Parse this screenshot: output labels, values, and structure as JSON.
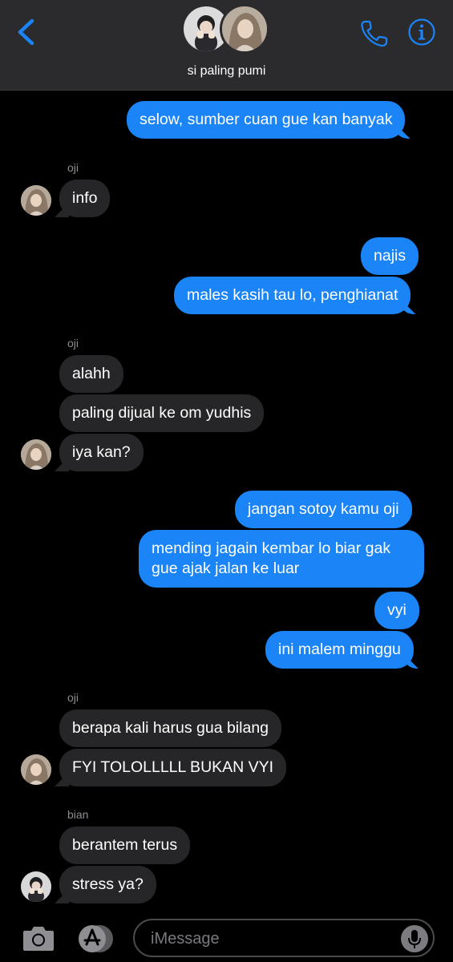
{
  "header": {
    "group_name": "si paling pumi",
    "accent_color": "#1b84f6",
    "icons": [
      "back-chevron-icon",
      "phone-icon",
      "info-icon"
    ]
  },
  "messages": [
    {
      "id": "m1",
      "dir": "out",
      "text": "selow, sumber cuan gue kan banyak"
    },
    {
      "id": "m2",
      "dir": "in",
      "sender": "oji",
      "text": "info"
    },
    {
      "id": "m3",
      "dir": "out",
      "text": "najis"
    },
    {
      "id": "m4",
      "dir": "out",
      "text": "males kasih tau lo, penghianat"
    },
    {
      "id": "m5",
      "dir": "in",
      "sender": "oji",
      "text": "alahh"
    },
    {
      "id": "m6",
      "dir": "in",
      "text": "paling dijual ke om yudhis"
    },
    {
      "id": "m7",
      "dir": "in",
      "text": "iya kan?"
    },
    {
      "id": "m8",
      "dir": "out",
      "text": "jangan sotoy kamu oji"
    },
    {
      "id": "m9",
      "dir": "out",
      "text_lines": [
        "mending jagain kembar lo biar gak",
        "gue ajak jalan ke luar"
      ]
    },
    {
      "id": "m10",
      "dir": "out",
      "text": "vyi"
    },
    {
      "id": "m11",
      "dir": "out",
      "text": "ini malem minggu"
    },
    {
      "id": "m12",
      "dir": "in",
      "sender": "oji",
      "text": "berapa kali harus gua bilang"
    },
    {
      "id": "m13",
      "dir": "in",
      "text": "FYI TOLOLLLLL BUKAN VYI"
    },
    {
      "id": "m14",
      "dir": "in",
      "sender": "bian",
      "text": "berantem terus"
    },
    {
      "id": "m15",
      "dir": "in",
      "text": "stress ya?"
    }
  ],
  "input": {
    "placeholder": "iMessage",
    "icons": [
      "camera-icon",
      "app-store-icon",
      "microphone-icon"
    ]
  }
}
